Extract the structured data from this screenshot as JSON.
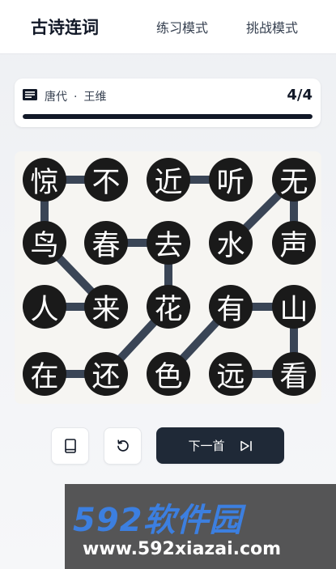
{
  "header": {
    "brand": "古诗连词",
    "nav": [
      {
        "label": "练习模式"
      },
      {
        "label": "挑战模式"
      }
    ]
  },
  "poem": {
    "icon": "book-open-icon",
    "dynasty": "唐代",
    "separator": "·",
    "author": "王维",
    "counter": "4/4",
    "progress": 1.0
  },
  "board": {
    "colors": {
      "cell": "#1a1a1a",
      "line": "#3a4556",
      "text": "#ffffff"
    },
    "rows": [
      [
        "惊",
        "不",
        "近",
        "听",
        "无"
      ],
      [
        "鸟",
        "春",
        "去",
        "水",
        "声"
      ],
      [
        "人",
        "来",
        "花",
        "有",
        "山"
      ],
      [
        "在",
        "还",
        "色",
        "远",
        "看"
      ]
    ],
    "connections": [
      [
        [
          0,
          0
        ],
        [
          0,
          1
        ]
      ],
      [
        [
          0,
          0
        ],
        [
          1,
          0
        ]
      ],
      [
        [
          1,
          0
        ],
        [
          2,
          1
        ]
      ],
      [
        [
          2,
          0
        ],
        [
          2,
          1
        ]
      ],
      [
        [
          3,
          0
        ],
        [
          3,
          1
        ]
      ],
      [
        [
          3,
          1
        ],
        [
          2,
          2
        ]
      ],
      [
        [
          2,
          2
        ],
        [
          1,
          2
        ]
      ],
      [
        [
          1,
          1
        ],
        [
          1,
          2
        ]
      ],
      [
        [
          0,
          2
        ],
        [
          0,
          3
        ]
      ],
      [
        [
          0,
          3
        ],
        [
          0,
          3
        ]
      ],
      [
        [
          1,
          3
        ],
        [
          0,
          4
        ]
      ],
      [
        [
          0,
          4
        ],
        [
          1,
          4
        ]
      ],
      [
        [
          3,
          2
        ],
        [
          2,
          3
        ]
      ],
      [
        [
          2,
          3
        ],
        [
          2,
          4
        ]
      ],
      [
        [
          2,
          4
        ],
        [
          3,
          4
        ]
      ],
      [
        [
          3,
          3
        ],
        [
          3,
          4
        ]
      ]
    ]
  },
  "actions": {
    "book_icon": "book-icon",
    "reset_icon": "rotate-ccw-icon",
    "next_label": "下一首",
    "next_icon": "skip-forward-icon"
  },
  "watermark": {
    "title": "592软件园",
    "url": "www.592xiazai.com"
  }
}
